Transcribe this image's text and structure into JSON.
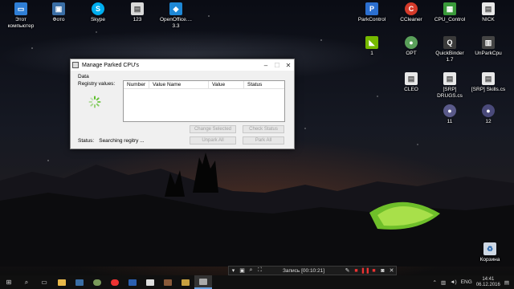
{
  "desktop_icons": [
    {
      "label": "Этот\nкомпьютер",
      "color": "#2f7fd6",
      "icon": "computer-icon",
      "glyph": "▭"
    },
    {
      "label": "Фото",
      "color": "#3a6ea5",
      "icon": "photos-icon",
      "glyph": "▣"
    },
    {
      "label": "Skype",
      "color": "#00aff0",
      "icon": "skype-icon",
      "glyph": "S"
    },
    {
      "label": "123",
      "color": "#d9d9d9",
      "icon": "file-icon",
      "glyph": "▤"
    },
    {
      "label": "OpenOffice....\n3.3",
      "color": "#1e88d6",
      "icon": "openoffice-icon",
      "glyph": "◆"
    },
    {
      "label": "ParkControl",
      "color": "#2b6fd0",
      "icon": "parkcontrol-icon",
      "glyph": "P"
    },
    {
      "label": "CCleaner",
      "color": "#d43a2a",
      "icon": "ccleaner-icon",
      "glyph": "C"
    },
    {
      "label": "CPU_Control",
      "color": "#3a9a3a",
      "icon": "cpu-control-icon",
      "glyph": "▦"
    },
    {
      "label": "NICK",
      "color": "#e8e8e8",
      "icon": "file-icon",
      "glyph": "▤"
    },
    {
      "label": "1",
      "color": "#76b900",
      "icon": "nvidia-icon",
      "glyph": "◣"
    },
    {
      "label": "OPT",
      "color": "#5aa05a",
      "icon": "app-icon",
      "glyph": "●"
    },
    {
      "label": "QuickBinder\n1.7",
      "color": "#3a3a3a",
      "icon": "quickbinder-icon",
      "glyph": "Q"
    },
    {
      "label": "UnParkCpu",
      "color": "#444444",
      "icon": "unparkcpu-icon",
      "glyph": "▥"
    },
    {
      "label": "CLEO",
      "color": "#e8e8e8",
      "icon": "file-icon",
      "glyph": "▤"
    },
    {
      "label": "[SRP]\nDRUGS.cs",
      "color": "#e8e8e8",
      "icon": "file-icon",
      "glyph": "▤"
    },
    {
      "label": "[SRP] Skills.cs",
      "color": "#e8e8e8",
      "icon": "file-icon",
      "glyph": "▤"
    },
    {
      "label": "11",
      "color": "#5a5a8a",
      "icon": "app-icon",
      "glyph": "●"
    },
    {
      "label": "12",
      "color": "#4a4a7a",
      "icon": "app-icon",
      "glyph": "●"
    },
    {
      "label": "Корзина",
      "color": "#cfd8e3",
      "icon": "recycle-bin-icon",
      "glyph": "♻"
    }
  ],
  "dialog": {
    "title": "Manage Parked CPU's",
    "group_label": "Data",
    "registry_label": "Registry values:",
    "columns": [
      "Number",
      "Value Name",
      "Value",
      "Status"
    ],
    "buttons": [
      "Change Selected",
      "Check Status",
      "Unpark All",
      "Park All"
    ],
    "status_label": "Status:",
    "status_value": "Searching regitry ..."
  },
  "recorder": {
    "text": "Запись [00:10:21]"
  },
  "taskbar": {
    "tray_language": "ENG",
    "time": "14:41",
    "date": "06.12.2016"
  }
}
